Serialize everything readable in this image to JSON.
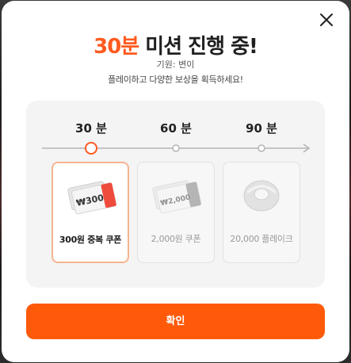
{
  "modal": {
    "title_accent": "30분",
    "title_rest": " 미션 진행 중!",
    "sponsor_line": "기원: 변이",
    "subtitle": "플레이하고 다양한 보상을 획득하세요!",
    "confirm_label": "확인",
    "accent_color": "#ff5a0a"
  },
  "steps": [
    {
      "label": "30 분",
      "state": "current"
    },
    {
      "label": "60 분",
      "state": "locked"
    },
    {
      "label": "90 분",
      "state": "locked"
    }
  ],
  "rewards": [
    {
      "label": "300원 중복 쿠폰",
      "ticket_text": "₩300",
      "icon": "coupon-icon",
      "selected": true
    },
    {
      "label": "2,000원 쿠폰",
      "ticket_text": "₩2,000",
      "icon": "coupon-icon",
      "selected": false
    },
    {
      "label": "20,000 플레이크",
      "icon": "flake-icon",
      "selected": false
    }
  ]
}
